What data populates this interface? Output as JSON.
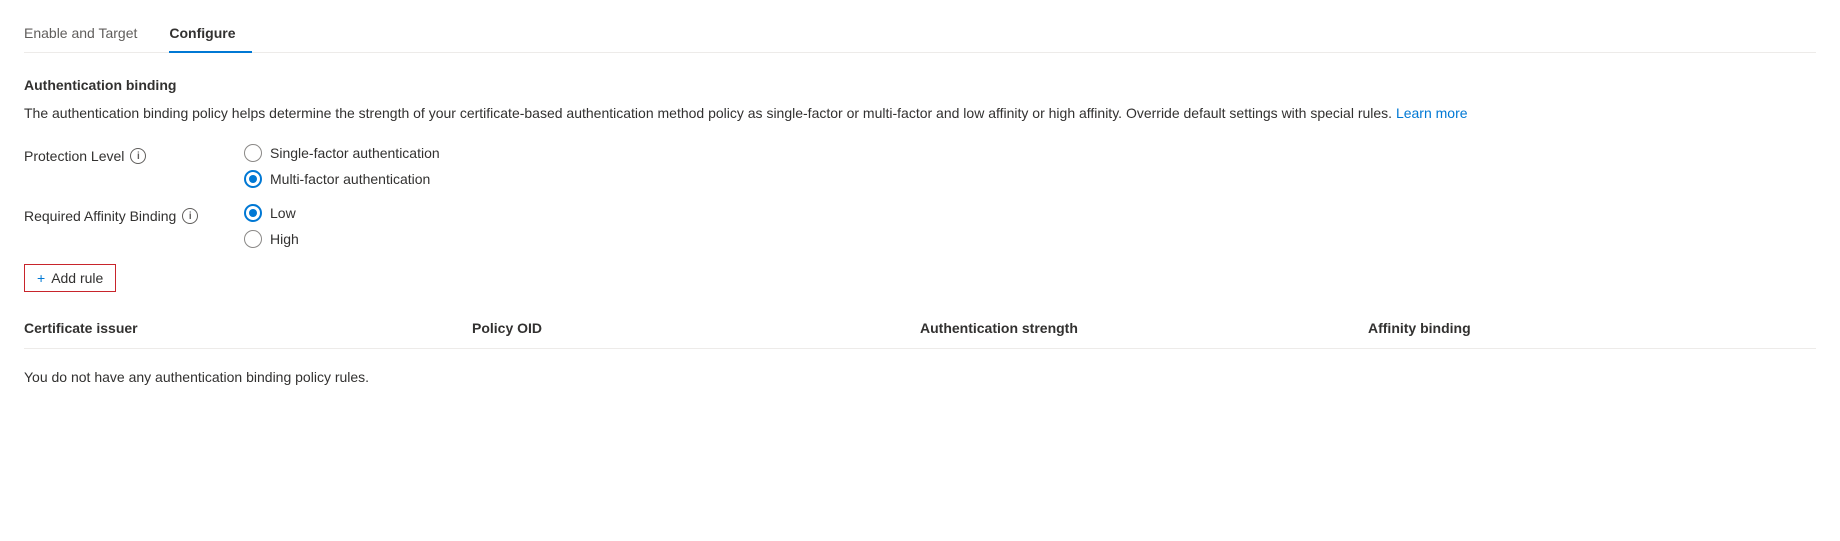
{
  "tabs": [
    {
      "id": "enable-target",
      "label": "Enable and Target",
      "active": false
    },
    {
      "id": "configure",
      "label": "Configure",
      "active": true
    }
  ],
  "section": {
    "title": "Authentication binding",
    "description": "The authentication binding policy helps determine the strength of your certificate-based authentication method policy as single-factor or multi-factor and low affinity or high affinity. Override default settings with special rules.",
    "learn_more_label": "Learn more"
  },
  "protection_level": {
    "label": "Protection Level",
    "options": [
      {
        "id": "single-factor",
        "label": "Single-factor authentication",
        "selected": false
      },
      {
        "id": "multi-factor",
        "label": "Multi-factor authentication",
        "selected": true
      }
    ]
  },
  "affinity_binding": {
    "label": "Required Affinity Binding",
    "options": [
      {
        "id": "low",
        "label": "Low",
        "selected": true
      },
      {
        "id": "high",
        "label": "High",
        "selected": false
      }
    ]
  },
  "add_rule_button": "+ Add rule",
  "table": {
    "columns": [
      {
        "id": "cert-issuer",
        "label": "Certificate issuer"
      },
      {
        "id": "policy-oid",
        "label": "Policy OID"
      },
      {
        "id": "auth-strength",
        "label": "Authentication strength"
      },
      {
        "id": "affinity-binding",
        "label": "Affinity binding"
      }
    ],
    "empty_message": "You do not have any authentication binding policy rules."
  }
}
